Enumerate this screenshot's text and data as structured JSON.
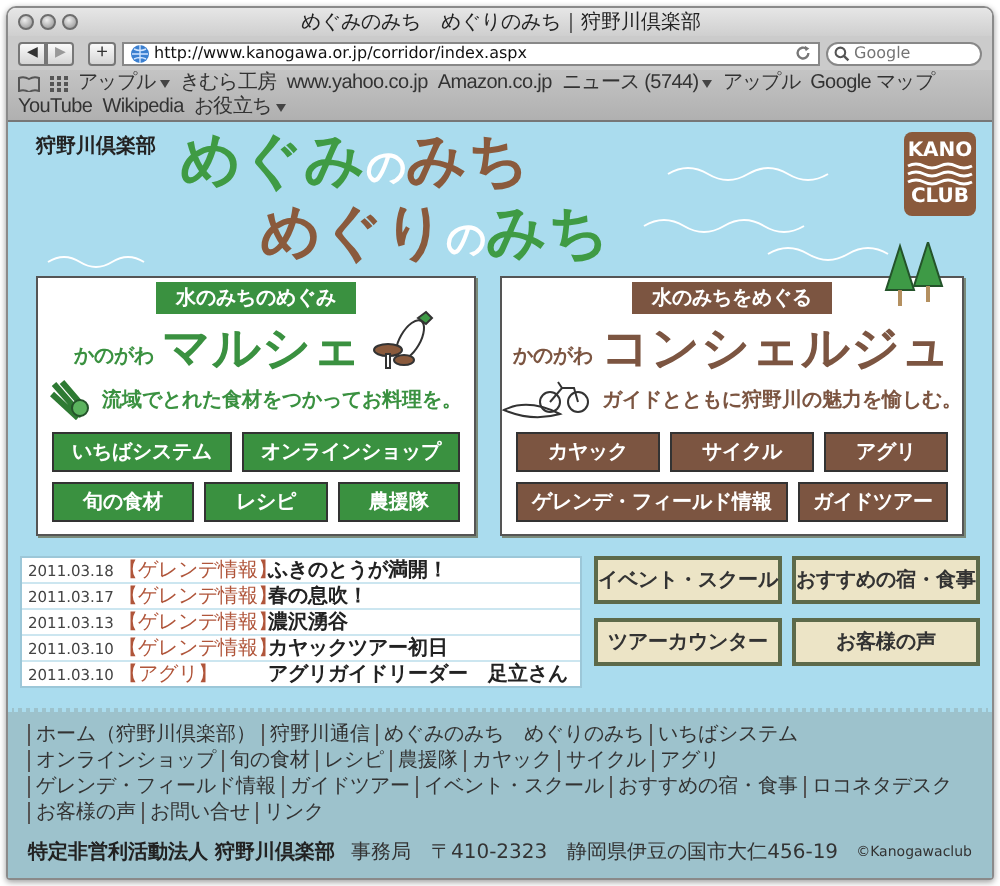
{
  "window": {
    "title": "めぐみのみち　めぐりのみち｜狩野川倶楽部"
  },
  "toolbar": {
    "back": "◀",
    "forward": "▶",
    "add": "+",
    "url": "http://www.kanogawa.or.jp/corridor/index.aspx",
    "search_placeholder": "Google"
  },
  "bookmarks": [
    {
      "label": "アップル",
      "menu": true
    },
    {
      "label": "きむら工房",
      "menu": false
    },
    {
      "label": "www.yahoo.co.jp",
      "menu": false
    },
    {
      "label": "Amazon.co.jp",
      "menu": false
    },
    {
      "label": "ニュース (5744)",
      "menu": true
    },
    {
      "label": "アップル",
      "menu": false
    },
    {
      "label": "Google マップ",
      "menu": false
    },
    {
      "label": "YouTube",
      "menu": false
    },
    {
      "label": "Wikipedia",
      "menu": false
    },
    {
      "label": "お役立ち",
      "menu": true
    }
  ],
  "header": {
    "org": "狩野川倶楽部",
    "title_lines": [
      [
        {
          "text": "めぐみ",
          "color": "#3f9b44"
        },
        {
          "text": "の",
          "color": "#ffffff"
        },
        {
          "text": "みち",
          "color": "#8a5a3c"
        }
      ],
      [
        {
          "text": "めぐり",
          "color": "#8a5a3c"
        },
        {
          "text": "の",
          "color": "#ffffff"
        },
        {
          "text": "みち",
          "color": "#3f9b44"
        }
      ]
    ],
    "logo": {
      "top": "KANO",
      "bottom": "CLUB"
    }
  },
  "panels": [
    {
      "kind": "marche",
      "tag": "水のみちのめぐみ",
      "prefix": "かのがわ",
      "name": "マルシェ",
      "description": "流域でとれた食材をつかってお料理を。",
      "button_rows": [
        [
          "いちばシステム",
          "オンラインショップ"
        ],
        [
          "旬の食材",
          "レシピ",
          "農援隊"
        ]
      ]
    },
    {
      "kind": "concierge",
      "tag": "水のみちをめぐる",
      "prefix": "かのがわ",
      "name": "コンシェルジュ",
      "description": "ガイドとともに狩野川の魅力を愉しむ。",
      "button_rows": [
        [
          "カヤック",
          "サイクル",
          "アグリ"
        ],
        [
          "ゲレンデ・フィールド情報",
          "ガイドツアー"
        ]
      ]
    }
  ],
  "news": [
    {
      "date": "2011.03.18",
      "category": "【ゲレンデ情報】",
      "title": "ふきのとうが満開！"
    },
    {
      "date": "2011.03.17",
      "category": "【ゲレンデ情報】",
      "title": "春の息吹！"
    },
    {
      "date": "2011.03.13",
      "category": "【ゲレンデ情報】",
      "title": "濃沢湧谷"
    },
    {
      "date": "2011.03.10",
      "category": "【ゲレンデ情報】",
      "title": "カヤックツアー初日"
    },
    {
      "date": "2011.03.10",
      "category": "【アグリ】",
      "title": "アグリガイドリーダー　足立さん"
    }
  ],
  "quick_links": [
    "イベント・スクール",
    "おすすめの宿・食事",
    "ツアーカウンター",
    "お客様の声"
  ],
  "footer": {
    "links": [
      "ホーム（狩野川倶楽部）",
      "狩野川通信",
      "めぐみのみち　めぐりのみち",
      "いちばシステム",
      "オンラインショップ",
      "旬の食材",
      "レシピ",
      "農援隊",
      "カヤック",
      "サイクル",
      "アグリ",
      "ゲレンデ・フィールド情報",
      "ガイドツアー",
      "イベント・スクール",
      "おすすめの宿・食事",
      "ロコネタデスク",
      "お客様の声",
      "お問い合せ",
      "リンク"
    ],
    "org": "特定非営利活動法人 狩野川倶楽部",
    "office": "事務局　〒410-2323　静岡県伊豆の国市大仁456-19",
    "copyright": "©Kanogawaclub"
  }
}
